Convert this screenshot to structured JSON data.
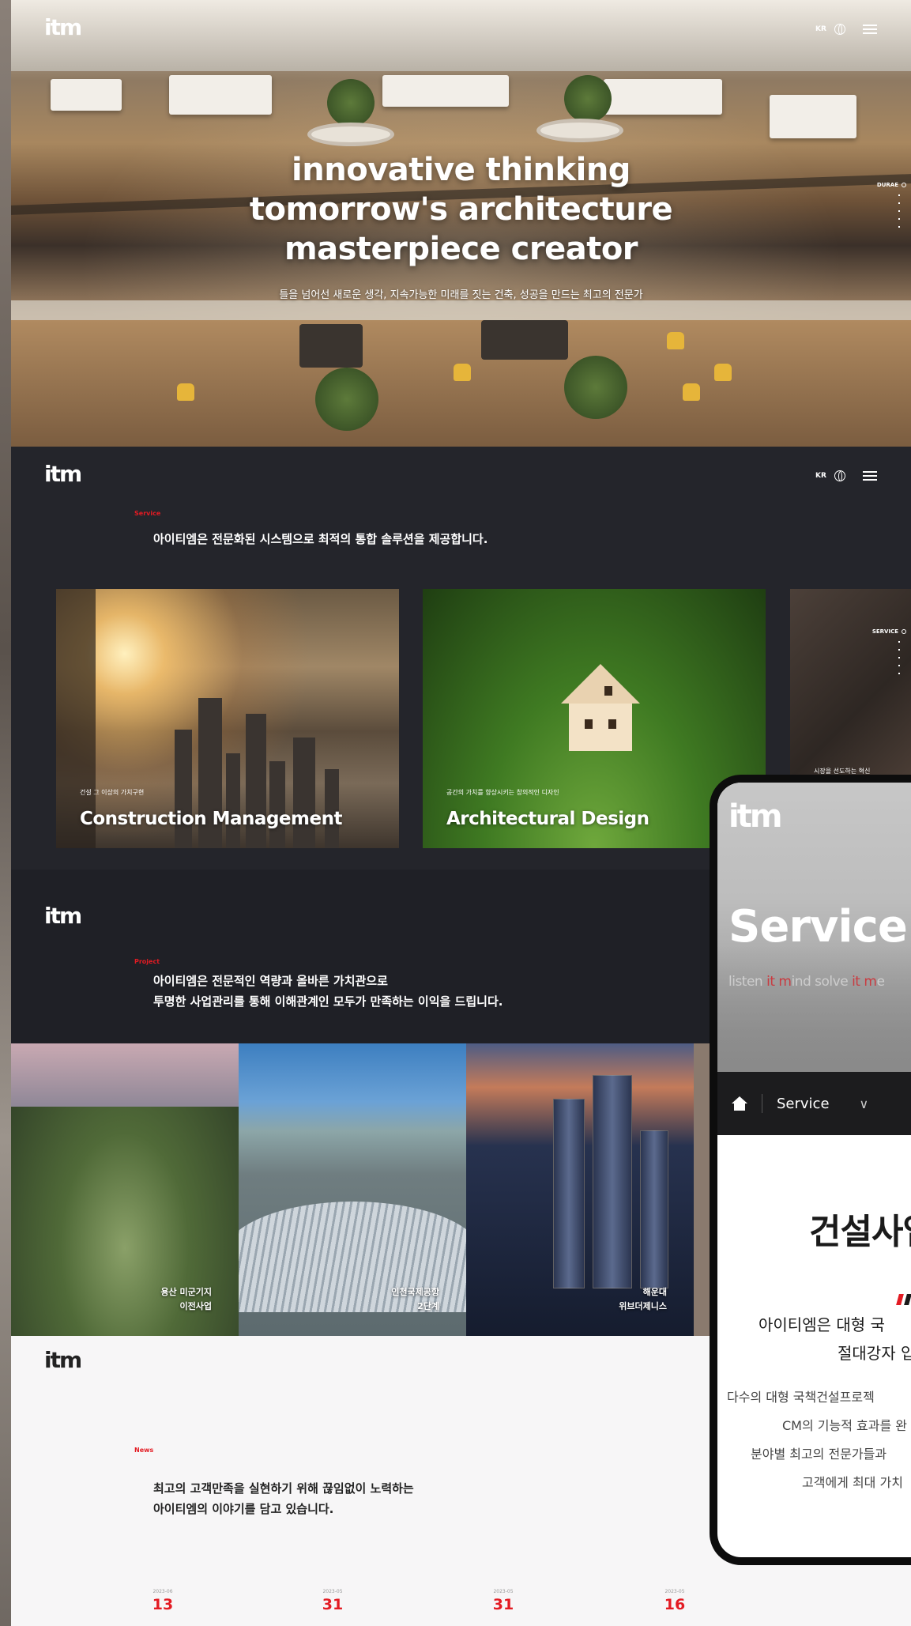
{
  "header": {
    "logo": "itm",
    "lang": "KR"
  },
  "hero": {
    "title_lines": [
      "innovative thinking",
      "tomorrow's architecture",
      "masterpiece creator"
    ],
    "subtitle": "틀을 넘어선 새로운 생각, 지속가능한 미래를 짓는 건축, 성공을 만드는 최고의 전문가",
    "side_label": "DURAE"
  },
  "service": {
    "label": "Service",
    "heading": "아이티엠은 전문화된 시스템으로 최적의 통합 솔루션을 제공합니다.",
    "side_label": "SERVICE",
    "cards": [
      {
        "kicker": "건설 그 이상의 가치구현",
        "name": "Construction Management"
      },
      {
        "kicker": "공간의 가치를 향상시키는 창의적인 디자인",
        "name": "Architectural Design"
      },
      {
        "kicker": "시장을 선도하는 혁신",
        "name": ""
      }
    ]
  },
  "project": {
    "label": "Project",
    "heading_line1": "아이티엠은 전문적인 역량과 올바른 가치관으로",
    "heading_line2": "투명한 사업관리를 통해 이해관계인 모두가 만족하는 이익을 드립니다.",
    "items": [
      {
        "line1": "용산 미군기지",
        "line2": "이전사업"
      },
      {
        "line1": "인천국제공항",
        "line2": "2단계"
      },
      {
        "line1": "해운대",
        "line2": "위브더제니스"
      }
    ]
  },
  "news": {
    "label": "News",
    "heading_line1": "최고의 고객만족을 실현하기 위해 끊임없이 노력하는",
    "heading_line2": "아이티엠의 이야기를 담고 있습니다.",
    "items": [
      {
        "ym": "2023-06",
        "day": "13"
      },
      {
        "ym": "2023-05",
        "day": "31"
      },
      {
        "ym": "2023-05",
        "day": "31"
      },
      {
        "ym": "2023-05",
        "day": "16"
      }
    ]
  },
  "mobile": {
    "logo": "itm",
    "title": "Service",
    "tagline_a": "listen ",
    "tagline_b": "it m",
    "tagline_c": "ind solve ",
    "tagline_d": "it m",
    "tagline_e": "e",
    "nav_label": "Service",
    "heading": "건설사업",
    "lead_line1": "아이티엠은 대형 국",
    "lead_line2": "절대강자 입",
    "body": [
      "다수의 대형 국책건설프로젝",
      "CM의 기능적 효과를 완",
      "분야별 최고의 전문가들과",
      "고객에게 최대 가치"
    ]
  },
  "colors": {
    "accent": "#e31b23",
    "dark_bg": "#24252b",
    "news_bg": "#f7f6f7"
  }
}
